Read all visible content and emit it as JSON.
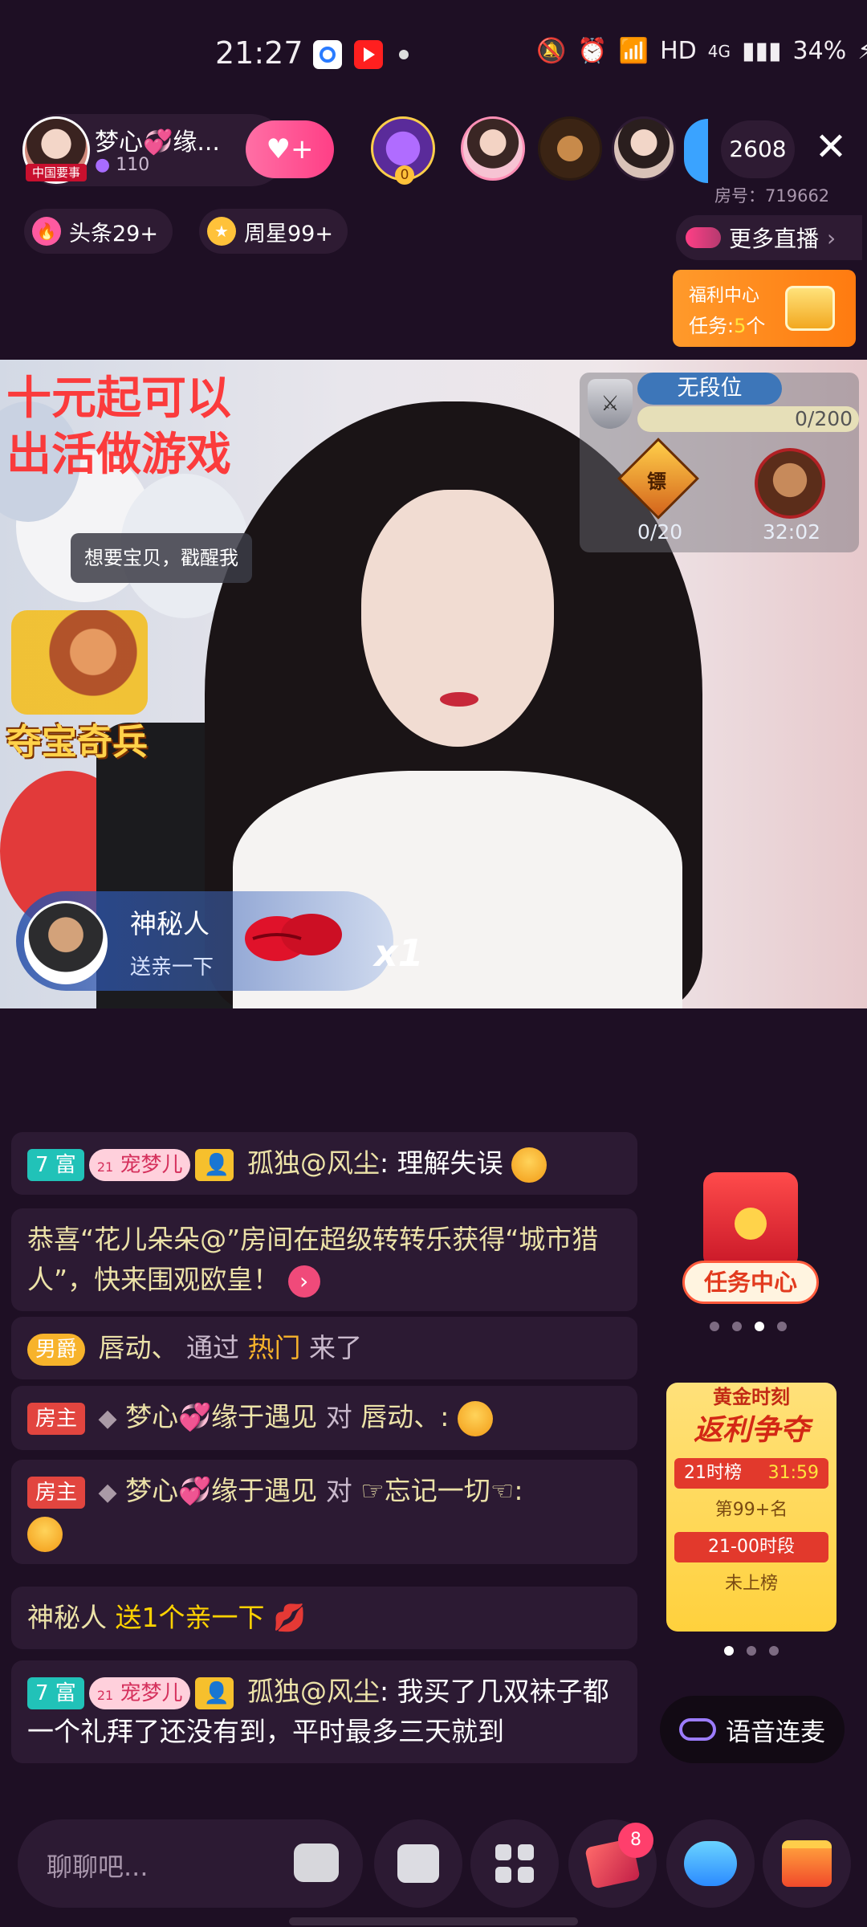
{
  "status_bar": {
    "time": "21:27",
    "network": "HD",
    "signal": "4G",
    "battery": "34%",
    "icons": [
      "tencent-app-icon",
      "youtube-icon",
      "mute-icon",
      "alarm-icon",
      "wifi-icon",
      "signal-icon",
      "battery-icon"
    ]
  },
  "header": {
    "host_name": "梦心💞缘...",
    "host_avatar_tag": "中国要事",
    "host_fans": "110",
    "follow_icon": "heart-plus-icon",
    "viewers": [
      {
        "name": "top-viewer-1",
        "badge": "0"
      },
      {
        "name": "viewer-2"
      },
      {
        "name": "viewer-3"
      },
      {
        "name": "viewer-4"
      }
    ],
    "viewer_count": "2608",
    "room_no": "房号：719662",
    "chips": [
      {
        "label": "头条29+",
        "icon": "flame-icon",
        "color": "#ff5aa0"
      },
      {
        "label": "周星99+",
        "icon": "star-icon",
        "color": "#ffc23a"
      }
    ],
    "more_live": "更多直播",
    "welfare": {
      "title": "福利中心",
      "task_prefix": "任务:",
      "task_count": "5",
      "task_suffix": "个"
    }
  },
  "video": {
    "promo_text_line1": "十元起可以",
    "promo_text_line2": "出活做游戏",
    "tooltip": "想要宝贝，戳醒我",
    "game_title": "夺宝奇兵",
    "rank": {
      "badge": "无段位",
      "progress_text": "0/200",
      "progress": 0,
      "item1_label": "镖",
      "item1_value": "0/20",
      "item2_value": "32:02"
    },
    "gift_banner": {
      "user": "神秘人",
      "action": "送亲一下",
      "multiplier": "x1"
    }
  },
  "chat": [
    {
      "level": "7 富",
      "pet_level": "21",
      "pet": "宠梦儿",
      "user": "孤独@风尘",
      "text": "理解失误"
    },
    {
      "system": "恭喜“花儿朵朵@”房间在超级转转乐获得“城市猎人”，快来围观欧皇！"
    },
    {
      "duke": "男爵",
      "user": "唇动、",
      "mid": "通过",
      "hot": "热门",
      "end": "来了"
    },
    {
      "host_tag": "房主",
      "user": "梦心💞缘于遇见",
      "to": "对",
      "target": "唇动、:"
    },
    {
      "host_tag": "房主",
      "user": "梦心💞缘于遇见",
      "to": "对",
      "target": "☞忘记一切☜:"
    },
    {
      "user": "神秘人",
      "gift_text": "送1个亲一下"
    },
    {
      "level": "7 富",
      "pet_level": "21",
      "pet": "宠梦儿",
      "user": "孤独@风尘",
      "text": "我买了几双袜子都一个礼拜了还没有到，平时最多三天就到"
    }
  ],
  "side": {
    "task_center": "任务中心",
    "gold_title1": "黄金时刻",
    "gold_title2": "返利争夺",
    "gold_rows": [
      {
        "left": "21时榜",
        "right": "31:59"
      },
      {
        "center": "第99+名"
      },
      {
        "center": "21-00时段"
      },
      {
        "center": "未上榜"
      }
    ],
    "voice_link": "语音连麦"
  },
  "bottom_bar": {
    "input_placeholder": "聊聊吧...",
    "gift_badge": "8"
  }
}
